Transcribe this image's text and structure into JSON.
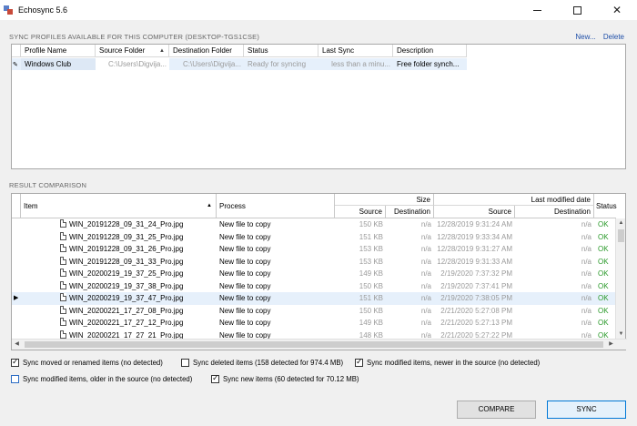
{
  "window": {
    "title": "Echosync 5.6"
  },
  "profiles_section": {
    "title": "SYNC PROFILES AVAILABLE FOR THIS COMPUTER (DESKTOP-TGS1CSE)",
    "new_label": "New...",
    "delete_label": "Delete",
    "columns": [
      "Profile Name",
      "Source Folder",
      "Destination Folder",
      "Status",
      "Last Sync",
      "Description"
    ],
    "row": {
      "profile_name": "Windows Club",
      "source_folder": "C:\\Users\\Digvija...",
      "destination_folder": "C:\\Users\\Digvija...",
      "status": "Ready for syncing",
      "last_sync": "less than a minu...",
      "description": "Free  folder synch..."
    }
  },
  "results_section": {
    "title": "RESULT COMPARISON",
    "columns": {
      "item": "Item",
      "process": "Process",
      "size": "Size",
      "last_modified": "Last modified date",
      "status": "Status",
      "source": "Source",
      "destination": "Destination"
    },
    "rows": [
      {
        "item": "WIN_20191228_09_31_24_Pro.jpg",
        "process": "New file to copy",
        "size_src": "150 KB",
        "size_dst": "n/a",
        "date_src": "12/28/2019 9:31:24 AM",
        "date_dst": "n/a",
        "status": "OK"
      },
      {
        "item": "WIN_20191228_09_31_25_Pro.jpg",
        "process": "New file to copy",
        "size_src": "151 KB",
        "size_dst": "n/a",
        "date_src": "12/28/2019 9:33:34 AM",
        "date_dst": "n/a",
        "status": "OK"
      },
      {
        "item": "WIN_20191228_09_31_26_Pro.jpg",
        "process": "New file to copy",
        "size_src": "153 KB",
        "size_dst": "n/a",
        "date_src": "12/28/2019 9:31:27 AM",
        "date_dst": "n/a",
        "status": "OK"
      },
      {
        "item": "WIN_20191228_09_31_33_Pro.jpg",
        "process": "New file to copy",
        "size_src": "153 KB",
        "size_dst": "n/a",
        "date_src": "12/28/2019 9:31:33 AM",
        "date_dst": "n/a",
        "status": "OK"
      },
      {
        "item": "WIN_20200219_19_37_25_Pro.jpg",
        "process": "New file to copy",
        "size_src": "149 KB",
        "size_dst": "n/a",
        "date_src": "2/19/2020 7:37:32 PM",
        "date_dst": "n/a",
        "status": "OK"
      },
      {
        "item": "WIN_20200219_19_37_38_Pro.jpg",
        "process": "New file to copy",
        "size_src": "150 KB",
        "size_dst": "n/a",
        "date_src": "2/19/2020 7:37:41 PM",
        "date_dst": "n/a",
        "status": "OK"
      },
      {
        "item": "WIN_20200219_19_37_47_Pro.jpg",
        "process": "New file to copy",
        "size_src": "151 KB",
        "size_dst": "n/a",
        "date_src": "2/19/2020 7:38:05 PM",
        "date_dst": "n/a",
        "status": "OK"
      },
      {
        "item": "WIN_20200221_17_27_08_Pro.jpg",
        "process": "New file to copy",
        "size_src": "150 KB",
        "size_dst": "n/a",
        "date_src": "2/21/2020 5:27:08 PM",
        "date_dst": "n/a",
        "status": "OK"
      },
      {
        "item": "WIN_20200221_17_27_12_Pro.jpg",
        "process": "New file to copy",
        "size_src": "149 KB",
        "size_dst": "n/a",
        "date_src": "2/21/2020 5:27:13 PM",
        "date_dst": "n/a",
        "status": "OK"
      },
      {
        "item": "WIN_20200221_17_27_21_Pro.jpg",
        "process": "New file to copy",
        "size_src": "148 KB",
        "size_dst": "n/a",
        "date_src": "2/21/2020 5:27:22 PM",
        "date_dst": "n/a",
        "status": "OK"
      }
    ]
  },
  "options": {
    "moved": "Sync moved or renamed items (no detected)",
    "deleted": "Sync deleted items (158 detected for 974.4 MB)",
    "modified_newer": "Sync modified items, newer in the source (no detected)",
    "modified_older": "Sync modified items, older in the source (no detected)",
    "new_items": "Sync new items (60 detected for 70.12 MB)"
  },
  "buttons": {
    "compare": "COMPARE",
    "sync": "SYNC"
  },
  "colors": {
    "ok": "#2a9a2a",
    "selection": "#e6f0fb",
    "link": "#1f4fa8"
  }
}
